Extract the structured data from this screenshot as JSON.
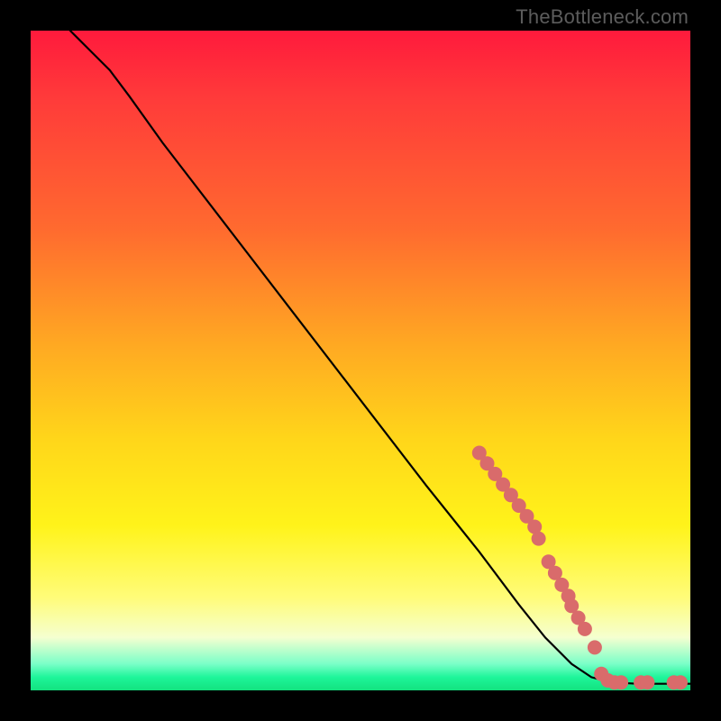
{
  "attribution": "TheBottleneck.com",
  "colors": {
    "background": "#000000",
    "marker": "#d96b6b",
    "curve": "#000000"
  },
  "chart_data": {
    "type": "line",
    "title": "",
    "xlabel": "",
    "ylabel": "",
    "xlim": [
      0,
      100
    ],
    "ylim": [
      0,
      100
    ],
    "curve": [
      {
        "x": 6,
        "y": 100
      },
      {
        "x": 7,
        "y": 99
      },
      {
        "x": 9,
        "y": 97
      },
      {
        "x": 12,
        "y": 94
      },
      {
        "x": 15,
        "y": 90
      },
      {
        "x": 20,
        "y": 83
      },
      {
        "x": 30,
        "y": 70
      },
      {
        "x": 40,
        "y": 57
      },
      {
        "x": 50,
        "y": 44
      },
      {
        "x": 60,
        "y": 31
      },
      {
        "x": 68,
        "y": 21
      },
      {
        "x": 74,
        "y": 13
      },
      {
        "x": 78,
        "y": 8
      },
      {
        "x": 82,
        "y": 4
      },
      {
        "x": 85,
        "y": 2
      },
      {
        "x": 88,
        "y": 1.2
      },
      {
        "x": 92,
        "y": 1.0
      },
      {
        "x": 96,
        "y": 1.0
      },
      {
        "x": 100,
        "y": 1.0
      }
    ],
    "markers": [
      {
        "x": 68.0,
        "y": 36.0
      },
      {
        "x": 69.2,
        "y": 34.4
      },
      {
        "x": 70.4,
        "y": 32.8
      },
      {
        "x": 71.6,
        "y": 31.2
      },
      {
        "x": 72.8,
        "y": 29.6
      },
      {
        "x": 74.0,
        "y": 28.0
      },
      {
        "x": 75.2,
        "y": 26.4
      },
      {
        "x": 76.4,
        "y": 24.8
      },
      {
        "x": 77.0,
        "y": 23.0
      },
      {
        "x": 78.5,
        "y": 19.5
      },
      {
        "x": 79.5,
        "y": 17.8
      },
      {
        "x": 80.5,
        "y": 16.0
      },
      {
        "x": 81.5,
        "y": 14.3
      },
      {
        "x": 82.0,
        "y": 12.8
      },
      {
        "x": 83.0,
        "y": 11.0
      },
      {
        "x": 84.0,
        "y": 9.3
      },
      {
        "x": 85.5,
        "y": 6.5
      },
      {
        "x": 86.5,
        "y": 2.5
      },
      {
        "x": 87.5,
        "y": 1.5
      },
      {
        "x": 88.5,
        "y": 1.2
      },
      {
        "x": 89.5,
        "y": 1.2
      },
      {
        "x": 92.5,
        "y": 1.2
      },
      {
        "x": 93.5,
        "y": 1.2
      },
      {
        "x": 97.5,
        "y": 1.2
      },
      {
        "x": 98.5,
        "y": 1.2
      }
    ]
  }
}
